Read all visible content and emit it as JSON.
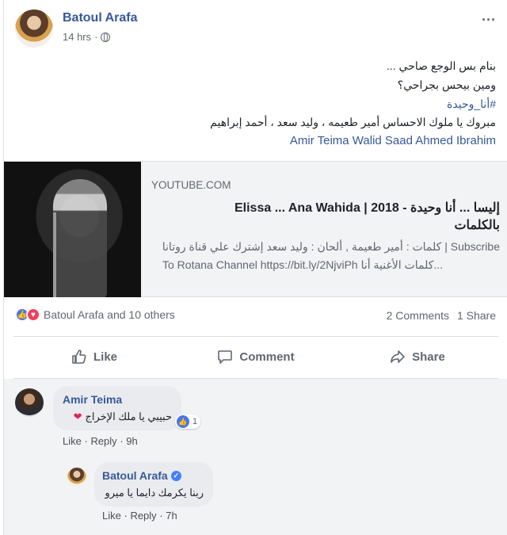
{
  "post": {
    "author": "Batoul Arafa",
    "time": "14 hrs",
    "dot": "·",
    "more": "...",
    "lines": [
      "بنام بس الوجع صاحي ...",
      "ومين بيحس بجراحي؟",
      "#أنا_وحيدة",
      "مبروك يا ملوك الاحساس أمير طعيمه ، وليد سعد ، أحمد إبراهيم"
    ],
    "tags": "Amir Teima Walid Saad Ahmed Ibrahim"
  },
  "link": {
    "domain": "YOUTUBE.COM",
    "title_line1": "إليسا ... أنا وحيدة - 2018 | Elissa ... Ana Wahida",
    "title_line2": "بالكلمات",
    "desc_line1": "Subscribe | كلمات : أمير طعيمة , ألحان : وليد سعد إشترك علي قناة روتانا",
    "desc_line2": "To Rotana Channel https://bit.ly/2NjviPh كلمات الأغنية أنا..."
  },
  "reactions": {
    "summary": "Batoul Arafa and 10 others",
    "comments": "2 Comments",
    "shares": "1 Share"
  },
  "actions": {
    "like": "Like",
    "comment": "Comment",
    "share": "Share"
  },
  "comments": [
    {
      "author": "Amir Teima",
      "text": "حبيبي يا ملك الإخراج",
      "like": "Like",
      "reply": "Reply",
      "time": "9h",
      "reaction_count": "1"
    },
    {
      "author": "Batoul Arafa",
      "text": "ربنا يكرمك دايما يا ميرو",
      "like": "Like",
      "reply": "Reply",
      "time": "7h"
    }
  ],
  "colors": {
    "link_blue": "#365899",
    "like_blue": "#4a76e8",
    "love_red": "#f0405b",
    "verified_blue": "#4080ff"
  }
}
